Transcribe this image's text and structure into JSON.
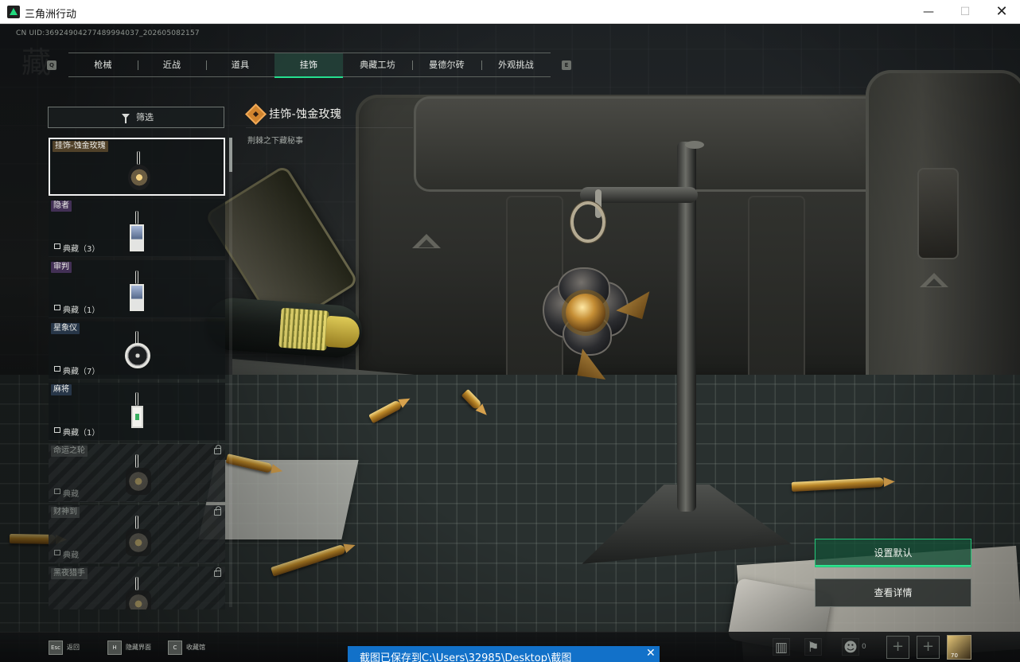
{
  "window": {
    "title": "三角洲行动",
    "min_glyph": "—",
    "max_glyph": "☐",
    "close_glyph": "✕"
  },
  "uid_text": "CN UID:36924904277489994037_202605082157",
  "watermark_text": "藏",
  "tab_shortcuts": {
    "left": "Q",
    "right": "E"
  },
  "tabs": [
    {
      "label": "枪械"
    },
    {
      "label": "近战"
    },
    {
      "label": "道具"
    },
    {
      "label": "挂饰",
      "active": true
    },
    {
      "label": "典藏工坊"
    },
    {
      "label": "曼德尔砖"
    },
    {
      "label": "外观挑战"
    }
  ],
  "filter": {
    "label": "筛选",
    "icon": "funnel-icon"
  },
  "items": [
    {
      "label": "挂饰-蚀金玫瑰",
      "selected": true,
      "rarity_color": "#54432a",
      "charm": "rose"
    },
    {
      "label": "隐者",
      "collect": "典藏（3）",
      "rarity_color": "#463258",
      "charm": "card"
    },
    {
      "label": "审判",
      "collect": "典藏（1）",
      "rarity_color": "#463258",
      "charm": "card"
    },
    {
      "label": "星象仪",
      "collect": "典藏（7）",
      "rarity_color": "#29384b",
      "charm": "astro"
    },
    {
      "label": "麻将",
      "collect": "典藏（1）",
      "rarity_color": "#29384b",
      "charm": "mahjong"
    },
    {
      "label": "命运之轮",
      "collect": "典藏",
      "locked": true,
      "charm": "dark"
    },
    {
      "label": "财神到",
      "collect": "典藏",
      "locked": true,
      "charm": "dark"
    },
    {
      "label": "黑夜猎手",
      "collect": "",
      "locked": true,
      "charm": "dark"
    }
  ],
  "detail": {
    "title": "挂饰-蚀金玫瑰",
    "subtitle": "荆棘之下藏秘事",
    "quality_icon": "orange-quality-icon"
  },
  "actions": {
    "set_default": "设置默认",
    "view_details": "查看详情"
  },
  "bottom_hints": [
    {
      "key": "Esc",
      "label": "返回"
    },
    {
      "key": "H",
      "label": "隐藏界面"
    },
    {
      "key": "C",
      "label": "收藏馆"
    }
  ],
  "bottom_status": {
    "friend_count": "0",
    "plus_glyph": "+",
    "avatar_level": "70"
  },
  "toast": {
    "text": "截图已保存到C:\\Users\\32985\\Desktop\\截图",
    "close": "✕"
  },
  "colors": {
    "accent": "#25e08f",
    "selected_tab_bg": "#26483d",
    "toast": "#1271c9",
    "gold": "#c58e35"
  }
}
